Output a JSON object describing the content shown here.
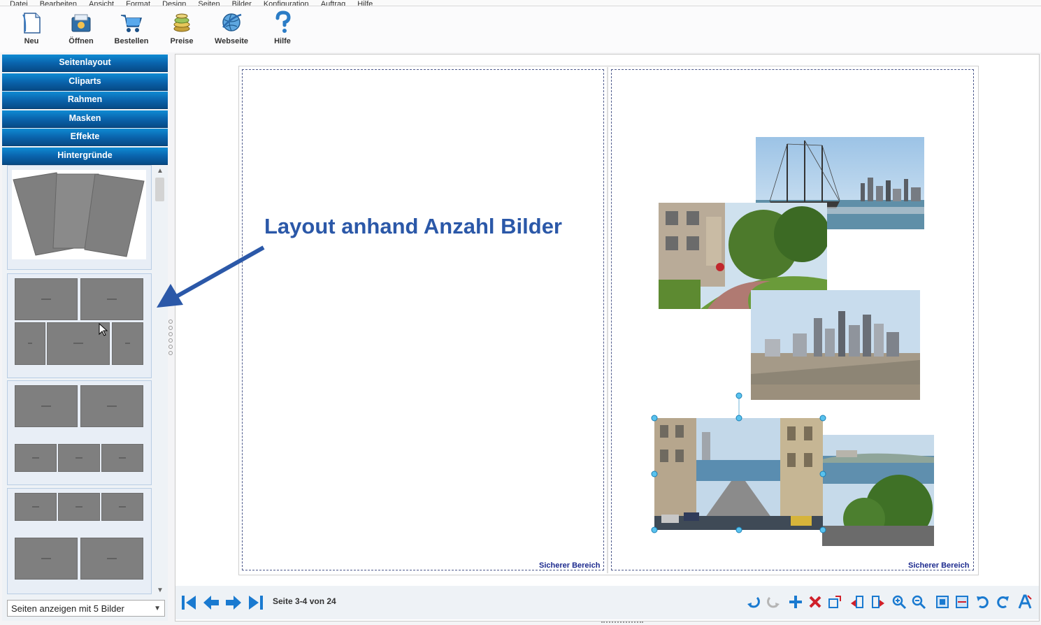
{
  "menu": {
    "items": [
      "Datei",
      "Bearbeiten",
      "Ansicht",
      "Format",
      "Design",
      "Seiten",
      "Bilder",
      "Konfiguration",
      "Auftrag",
      "Hilfe"
    ]
  },
  "toolbar": {
    "buttons": [
      {
        "label": "Neu",
        "icon": "new-document-icon"
      },
      {
        "label": "Öffnen",
        "icon": "open-folder-icon"
      },
      {
        "label": "Bestellen",
        "icon": "shopping-cart-icon"
      },
      {
        "label": "Preise",
        "icon": "coins-icon"
      },
      {
        "label": "Webseite",
        "icon": "globe-icon"
      },
      {
        "label": "Hilfe",
        "icon": "help-icon"
      }
    ]
  },
  "sidebar": {
    "sections": [
      "Seitenlayout",
      "Cliparts",
      "Rahmen",
      "Masken",
      "Effekte",
      "Hintergründe"
    ],
    "filter_select": {
      "value": "Seiten anzeigen mit 5 Bilder"
    }
  },
  "canvas": {
    "safe_area_label_left": "Sicherer Bereich",
    "safe_area_label_right": "Sicherer Bereich",
    "annotation": "Layout anhand Anzahl Bilder"
  },
  "navigation": {
    "page_info": "Seite 3-4 von 24",
    "buttons": [
      "first-page-icon",
      "previous-page-icon",
      "next-page-icon",
      "last-page-icon"
    ]
  },
  "tools": [
    "undo-icon",
    "redo-icon",
    "add-icon",
    "delete-icon",
    "export-icon",
    "move-left-icon",
    "move-right-icon",
    "zoom-in-icon",
    "zoom-out-icon",
    "fit-page-icon",
    "fit-width-icon",
    "rotate-left-icon",
    "rotate-right-icon",
    "text-icon"
  ],
  "colors": {
    "accent_blue": "#0a64ad",
    "annotation_blue": "#2b58a8",
    "safe_label": "#1c2a8e"
  }
}
